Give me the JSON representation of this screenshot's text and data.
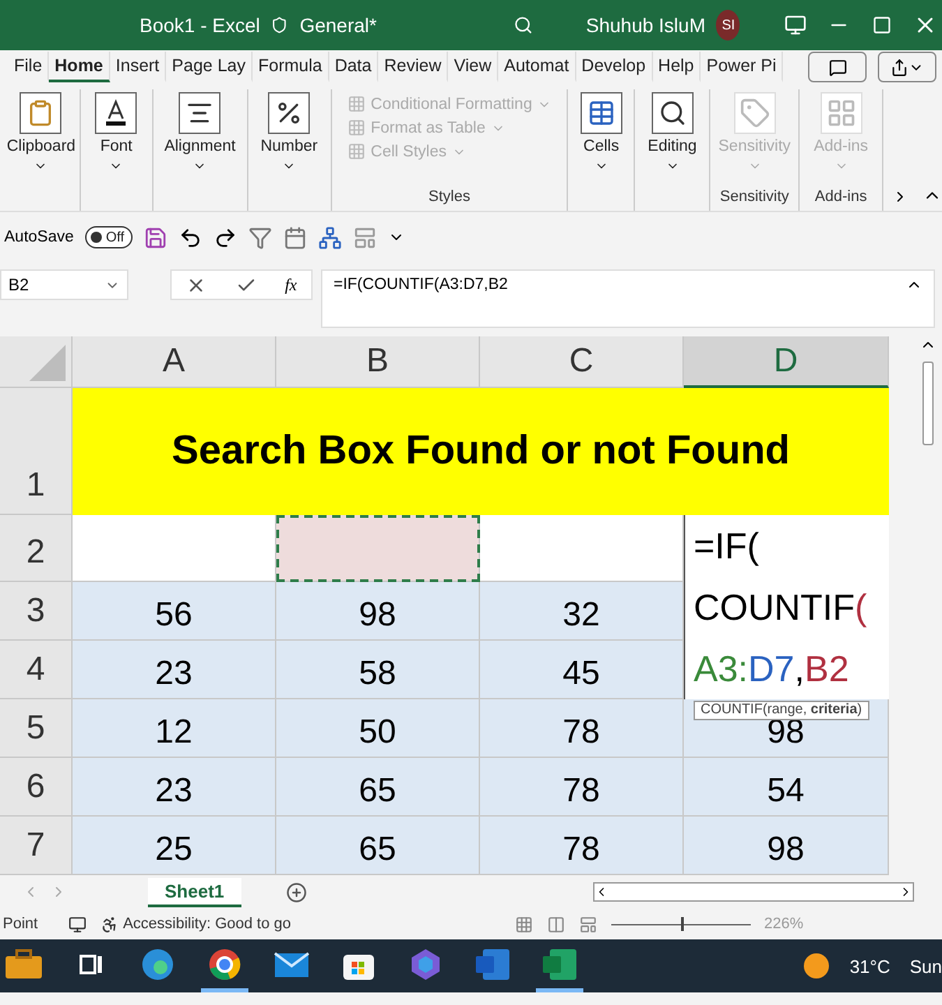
{
  "window": {
    "title": "Book1  -  Excel",
    "label": "General*",
    "user": "Shuhub IsluM",
    "initials": "SI"
  },
  "menu_tabs": [
    {
      "label": "File",
      "selected": false
    },
    {
      "label": "Home",
      "selected": true
    },
    {
      "label": "Insert",
      "selected": false
    },
    {
      "label": "Page Lay",
      "selected": false
    },
    {
      "label": "Formula",
      "selected": false
    },
    {
      "label": "Data",
      "selected": false
    },
    {
      "label": "Review",
      "selected": false
    },
    {
      "label": "View",
      "selected": false
    },
    {
      "label": "Automat",
      "selected": false
    },
    {
      "label": "Develop",
      "selected": false
    },
    {
      "label": "Help",
      "selected": false
    },
    {
      "label": "Power Pi",
      "selected": false
    }
  ],
  "ribbon": [
    {
      "kind": "clipboard",
      "label": "Clipboard",
      "disabled": false
    },
    {
      "kind": "font",
      "label": "Font",
      "disabled": false
    },
    {
      "kind": "alignment",
      "label": "Alignment",
      "disabled": false
    },
    {
      "kind": "number",
      "label": "Number",
      "disabled": false
    },
    {
      "kind": "styles",
      "group_label": "Styles",
      "items": [
        {
          "label": "Conditional Formatting",
          "disabled": true
        },
        {
          "label": "Format as Table",
          "disabled": true
        },
        {
          "label": "Cell Styles",
          "disabled": true
        }
      ]
    },
    {
      "kind": "cells",
      "label": "Cells",
      "disabled": false
    },
    {
      "kind": "editing",
      "label": "Editing",
      "disabled": false
    },
    {
      "kind": "sensitivity",
      "label": "Sensitivity",
      "disabled": true,
      "group_label": "Sensitivity"
    },
    {
      "kind": "addins",
      "label": "Add-ins",
      "disabled": true,
      "group_label": "Add-ins"
    }
  ],
  "quick_access": {
    "autosave_label": "AutoSave",
    "toggle_text": "Off",
    "on": false
  },
  "formula_bar": {
    "name_box": "B2",
    "fx_label": "fx",
    "formula": "=IF(COUNTIF(A3:D7,B2"
  },
  "grid": {
    "columns": [
      {
        "label": "A",
        "selected": false
      },
      {
        "label": "B",
        "selected": false
      },
      {
        "label": "C",
        "selected": false
      },
      {
        "label": "D",
        "selected": true
      }
    ],
    "banner": {
      "row": "1",
      "text": "Search Box Found or not Found"
    },
    "rows": [
      {
        "header": "2",
        "highlighted": false,
        "cells": [
          {},
          {
            "marquee": true
          },
          {}
        ]
      },
      {
        "header": "3",
        "highlighted": true,
        "cells": [
          {
            "text": "56"
          },
          {
            "text": "98"
          },
          {
            "text": "32"
          }
        ]
      },
      {
        "header": "4",
        "highlighted": true,
        "cells": [
          {
            "text": "23"
          },
          {
            "text": "58"
          },
          {
            "text": "45"
          }
        ]
      },
      {
        "header": "5",
        "highlighted": true,
        "cells": [
          {
            "text": "12"
          },
          {
            "text": "50"
          },
          {
            "text": "78"
          },
          {
            "text": "98"
          }
        ]
      },
      {
        "header": "6",
        "highlighted": true,
        "cells": [
          {
            "text": "23"
          },
          {
            "text": "65"
          },
          {
            "text": "78"
          },
          {
            "text": "54"
          }
        ]
      },
      {
        "header": "7",
        "highlighted": true,
        "cells": [
          {
            "text": "25"
          },
          {
            "text": "65"
          },
          {
            "text": "78"
          },
          {
            "text": "98"
          }
        ]
      }
    ],
    "editor": {
      "lines": [
        [
          {
            "text": "=IF(",
            "color": "#000000"
          }
        ],
        [
          {
            "text": "COUNTIF",
            "color": "#000000"
          },
          {
            "text": "(",
            "color": "#b03040"
          }
        ],
        [
          {
            "text": "A3:",
            "color": "#3a8a3a"
          },
          {
            "text": "D7",
            "color": "#2a62c0"
          },
          {
            "text": ",",
            "color": "#000000"
          },
          {
            "text": "B2",
            "color": "#b03040"
          }
        ]
      ],
      "tooltip": "COUNTIF(range, **criteria**)"
    }
  },
  "sheet_tabs": [
    {
      "label": "Sheet1",
      "selected": true
    }
  ],
  "status_bar": {
    "mode": "Point",
    "accessibility": "Accessibility: Good to go",
    "zoom": "226%",
    "zoom_level": {
      "level": 0.5
    }
  },
  "taskbar": {
    "apps": [
      {
        "kind": "briefcase",
        "active": false
      },
      {
        "kind": "taskview",
        "active": false
      },
      {
        "kind": "edge",
        "active": false
      },
      {
        "kind": "chrome",
        "active": true
      },
      {
        "kind": "mail",
        "active": false
      },
      {
        "kind": "store",
        "active": false
      },
      {
        "kind": "copilot",
        "active": false
      },
      {
        "kind": "word",
        "active": false
      },
      {
        "kind": "excel",
        "active": true
      }
    ],
    "temperature": "31°C",
    "weather_text": "Sun"
  }
}
